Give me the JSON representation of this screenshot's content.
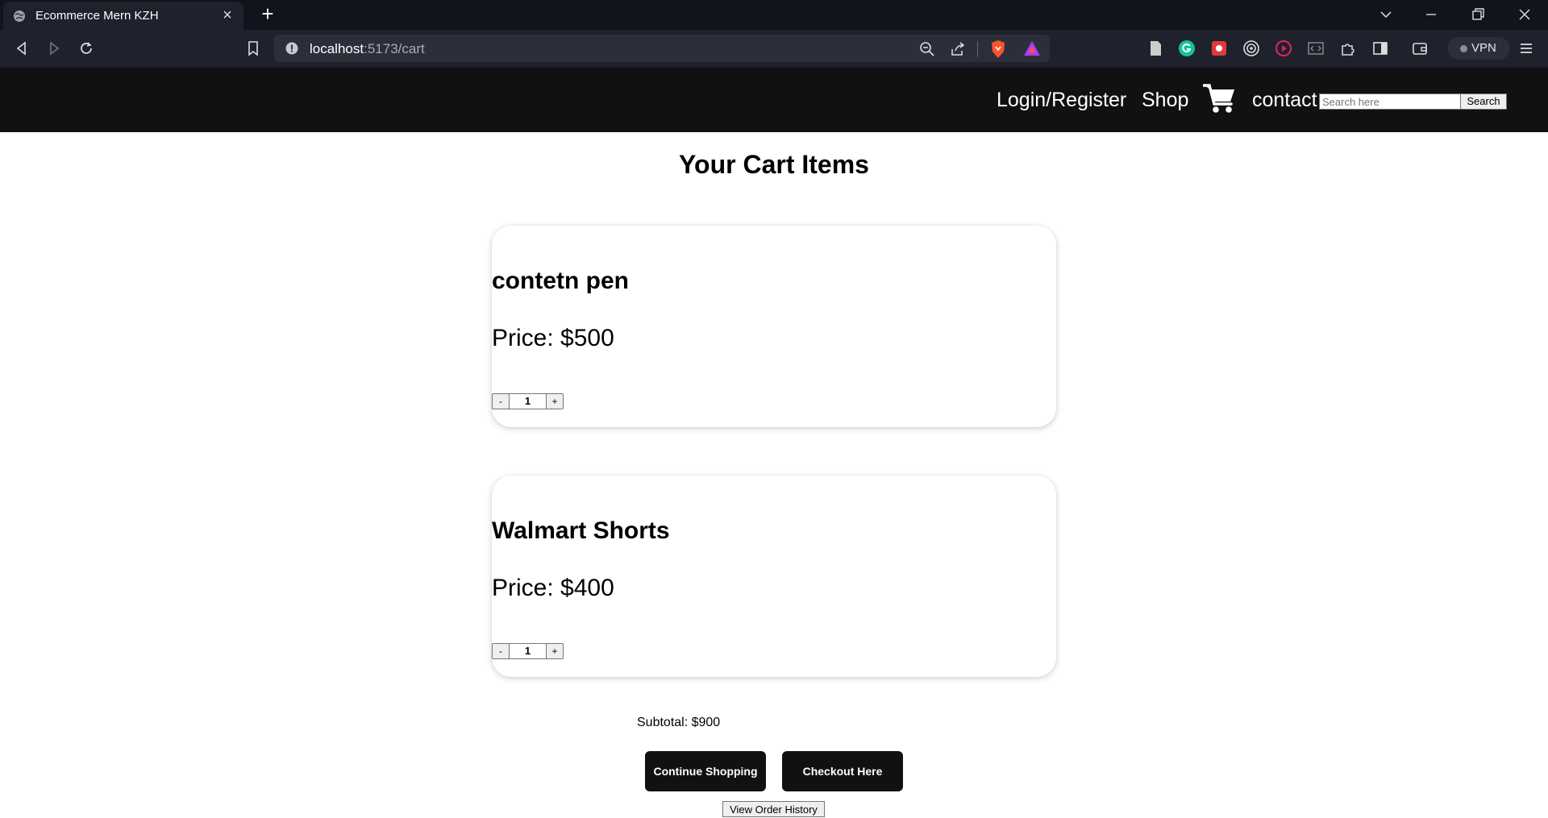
{
  "browser": {
    "tab_title": "Ecommerce Mern KZH",
    "url_host": "localhost",
    "url_path": ":5173/cart",
    "vpn_label": "VPN"
  },
  "navbar": {
    "links": [
      "Login/Register",
      "Shop",
      "contact"
    ],
    "search_placeholder": "Search here",
    "search_button": "Search"
  },
  "cart": {
    "title": "Your Cart Items",
    "items": [
      {
        "name": "contetn pen",
        "price_label": "Price: $500",
        "quantity": "1",
        "minus": "-",
        "plus": "+"
      },
      {
        "name": "Walmart Shorts",
        "price_label": "Price: $400",
        "quantity": "1",
        "minus": "-",
        "plus": "+"
      }
    ],
    "subtotal": "Subtotal: $900",
    "continue_label": "Continue Shopping",
    "checkout_label": "Checkout Here",
    "history_label": "View Order History"
  }
}
